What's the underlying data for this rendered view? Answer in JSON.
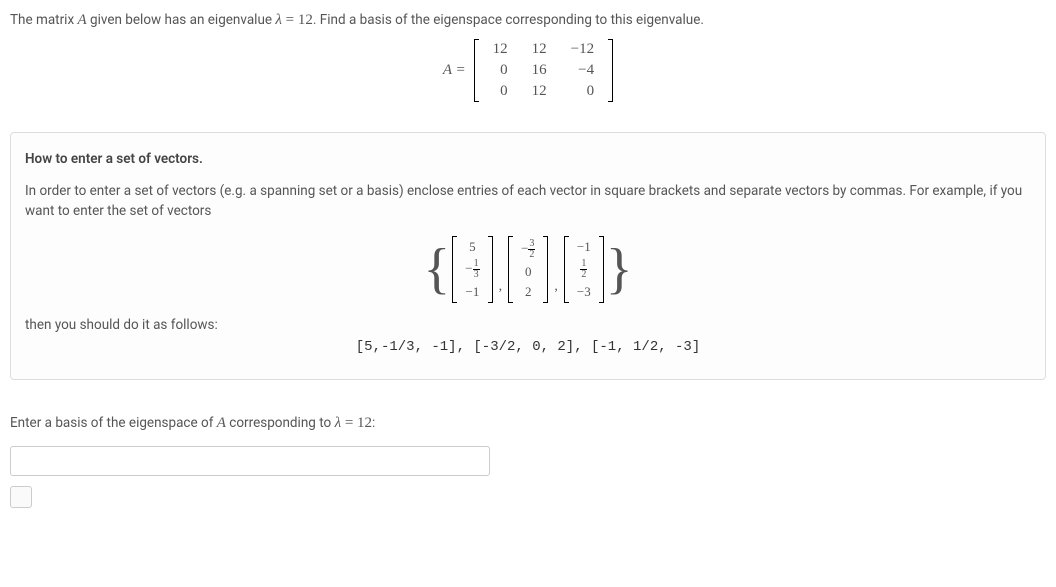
{
  "problem": {
    "intro_pre": "The matrix ",
    "A": "A",
    "intro_mid": " given below has an eigenvalue ",
    "lambda": "λ",
    "eq": " = ",
    "lambda_val": "12",
    "intro_post": ". Find a basis of the eigenspace corresponding to this eigenvalue."
  },
  "matrix": {
    "label": "A =",
    "rows": [
      [
        "12",
        "12",
        "−12"
      ],
      [
        "0",
        "16",
        "−4"
      ],
      [
        "0",
        "12",
        "0"
      ]
    ]
  },
  "info": {
    "title": "How to enter a set of vectors.",
    "text1": "In order to enter a set of vectors (e.g. a spanning set or a basis) enclose entries of each vector in square brackets and separate vectors by commas. For example, if you want to enter the set of vectors",
    "vectors": [
      [
        {
          "t": "n",
          "v": "5"
        },
        {
          "t": "negfrac",
          "n": "1",
          "d": "3"
        },
        {
          "t": "n",
          "v": "−1"
        }
      ],
      [
        {
          "t": "negfrac",
          "n": "3",
          "d": "2"
        },
        {
          "t": "n",
          "v": "0"
        },
        {
          "t": "n",
          "v": "2"
        }
      ],
      [
        {
          "t": "n",
          "v": "−1"
        },
        {
          "t": "frac",
          "n": "1",
          "d": "2"
        },
        {
          "t": "n",
          "v": "−3"
        }
      ]
    ],
    "then": "then you should do it as follows:",
    "code": "[5,-1/3, -1], [-3/2, 0, 2], [-1, 1/2, -3]"
  },
  "answer": {
    "label_pre": "Enter a basis of the eigenspace of ",
    "A": "A",
    "label_mid": " corresponding to ",
    "lambda": "λ",
    "eq": " = ",
    "lambda_val": "12",
    "label_post": ":"
  }
}
